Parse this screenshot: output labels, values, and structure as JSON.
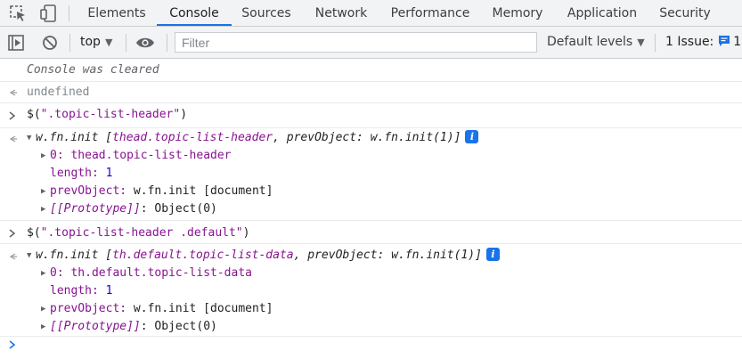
{
  "tabs": [
    "Elements",
    "Console",
    "Sources",
    "Network",
    "Performance",
    "Memory",
    "Application",
    "Security"
  ],
  "active_tab": "Console",
  "toolbar": {
    "context": "top",
    "filter_placeholder": "Filter",
    "levels": "Default levels",
    "issues_label": "1 Issue:",
    "issues_count": "1"
  },
  "console": {
    "cleared": "Console was cleared",
    "undefined": "undefined",
    "cmd1": {
      "prefix": "$(",
      "arg": "\".topic-list-header\"",
      "suffix": ")"
    },
    "res1": {
      "summary_obj": "w.fn.init ",
      "summary_lb": "[",
      "summary_item": "thead.topic-list-header",
      "summary_mid": ", prevObject: ",
      "summary_prev": "w.fn.init(1)",
      "summary_rb": "]",
      "info": "i",
      "k0": "0:",
      "v0": " thead.topic-list-header",
      "klen": "length:",
      "vlen": " 1",
      "kprev": "prevObject:",
      "vprev": " w.fn.init [document]",
      "kproto": "[[Prototype]]",
      "vproto": ": Object(0)"
    },
    "cmd2": {
      "prefix": "$(",
      "arg": "\".topic-list-header .default\"",
      "suffix": ")"
    },
    "res2": {
      "summary_obj": "w.fn.init ",
      "summary_lb": "[",
      "summary_item": "th.default.topic-list-data",
      "summary_mid": ", prevObject: ",
      "summary_prev": "w.fn.init(1)",
      "summary_rb": "]",
      "info": "i",
      "k0": "0:",
      "v0": " th.default.topic-list-data",
      "klen": "length:",
      "vlen": " 1",
      "kprev": "prevObject:",
      "vprev": " w.fn.init [document]",
      "kproto": "[[Prototype]]",
      "vproto": ": Object(0)"
    }
  }
}
